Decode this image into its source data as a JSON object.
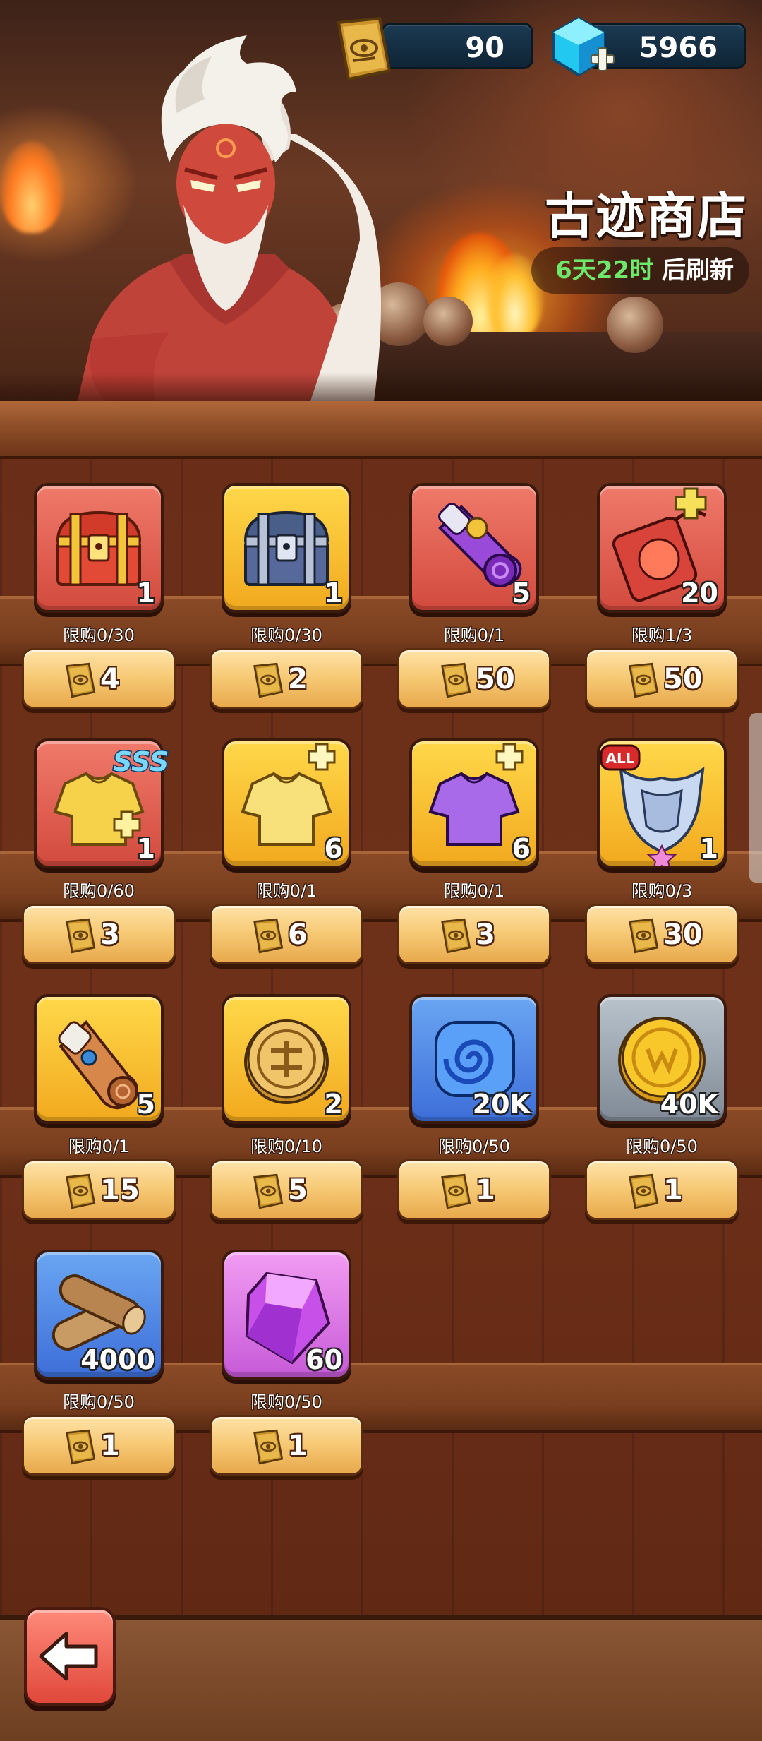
{
  "currencies": {
    "tickets": {
      "value": "90",
      "icon": "ancient-ticket-icon"
    },
    "gems": {
      "value": "5966",
      "icon": "blue-gem-add-icon"
    }
  },
  "shop": {
    "title": "古迹商店",
    "refresh_time": "6天22时",
    "refresh_suffix": " 后刷新"
  },
  "items": [
    {
      "name": "red-treasure-chest",
      "qty": "1",
      "limit": "限购0/30",
      "price": "4"
    },
    {
      "name": "blue-treasure-chest",
      "qty": "1",
      "limit": "限购0/30",
      "price": "2"
    },
    {
      "name": "purple-scroll",
      "qty": "5",
      "limit": "限购0/1",
      "price": "50"
    },
    {
      "name": "red-potion-shard",
      "qty": "20",
      "limit": "限购1/3",
      "price": "50"
    },
    {
      "name": "sss-gold-armor-shard",
      "qty": "1",
      "limit": "限购0/60",
      "price": "3",
      "badge": "SSS"
    },
    {
      "name": "gold-armor-shard",
      "qty": "6",
      "limit": "限购0/1",
      "price": "6"
    },
    {
      "name": "purple-armor-shard",
      "qty": "6",
      "limit": "限购0/1",
      "price": "3"
    },
    {
      "name": "all-silver-armor",
      "qty": "1",
      "limit": "限购0/3",
      "price": "30",
      "badge": "ALL"
    },
    {
      "name": "orange-scroll",
      "qty": "5",
      "limit": "限购0/1",
      "price": "15"
    },
    {
      "name": "gold-coin-token",
      "qty": "2",
      "limit": "限购0/10",
      "price": "5"
    },
    {
      "name": "blue-swirl-stone",
      "qty": "20K",
      "limit": "限购0/50",
      "price": "1"
    },
    {
      "name": "gold-coin",
      "qty": "40K",
      "limit": "限购0/50",
      "price": "1"
    },
    {
      "name": "wood-logs",
      "qty": "4000",
      "limit": "限购0/50",
      "price": "1"
    },
    {
      "name": "purple-crystal",
      "qty": "60",
      "limit": "限购0/50",
      "price": "1"
    }
  ],
  "back_button": {
    "icon": "back-arrow-icon"
  }
}
